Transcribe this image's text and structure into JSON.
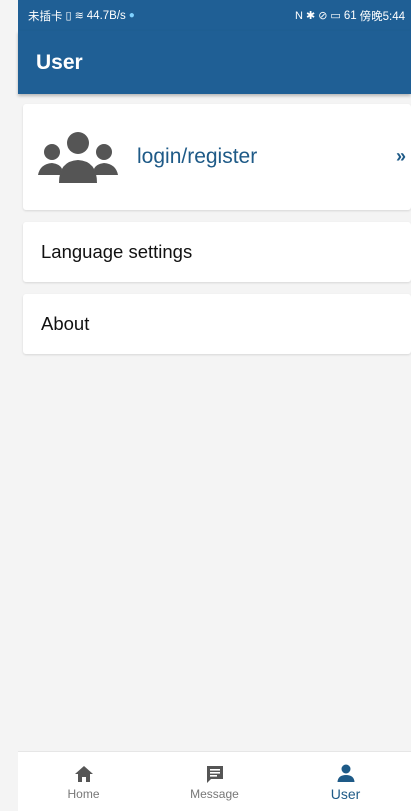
{
  "status_bar": {
    "carrier": "未插卡",
    "sim_icon": "sim-card-icon",
    "wifi_icon": "wifi-icon",
    "speed": "44.7B/s",
    "right_icons": [
      "nfc-icon",
      "bluetooth-icon",
      "mute-icon",
      "battery-icon"
    ],
    "battery": "61",
    "time": "傍晚5:44"
  },
  "header": {
    "title": "User"
  },
  "login_card": {
    "icon": "people-icon",
    "label": "login/register",
    "chevron": "»"
  },
  "menu": {
    "language": "Language settings",
    "about": "About"
  },
  "bottom_nav": {
    "items": [
      {
        "label": "Home",
        "icon": "home-icon"
      },
      {
        "label": "Message",
        "icon": "message-icon"
      },
      {
        "label": "User",
        "icon": "user-icon",
        "active": true
      }
    ]
  },
  "colors": {
    "primary": "#1f5f95",
    "accent_text": "#1e5a87",
    "icon_gray": "#555555",
    "background": "#f4f4f4"
  }
}
